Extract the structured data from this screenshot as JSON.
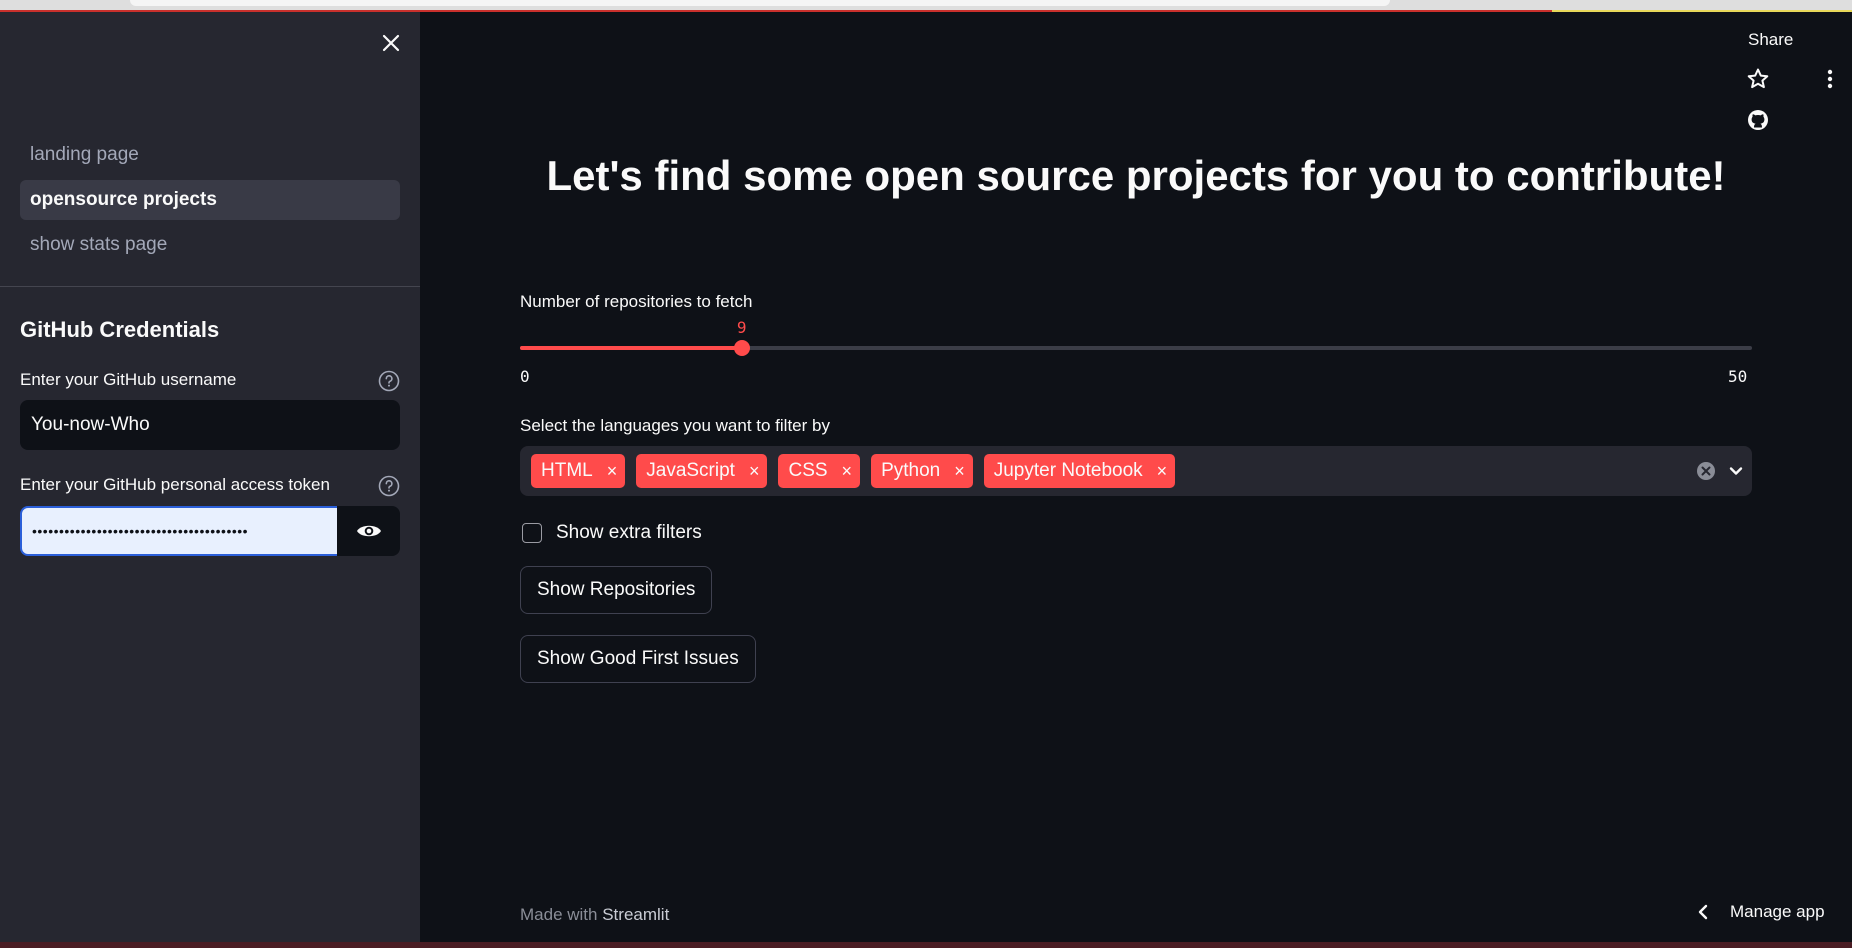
{
  "sidebar": {
    "nav_items": [
      {
        "label": "landing page",
        "active": false
      },
      {
        "label": "opensource projects",
        "active": true
      },
      {
        "label": "show stats page",
        "active": false
      }
    ],
    "section_title": "GitHub Credentials",
    "username_label": "Enter your GitHub username",
    "username_value": "You-now-Who",
    "token_label": "Enter your GitHub personal access token",
    "token_value": "••••••••••••••••••••••••••••••••••••••••"
  },
  "header": {
    "share_label": "Share"
  },
  "main": {
    "title": "Let's find some open source projects for you to contribute!",
    "slider": {
      "label": "Number of repositories to fetch",
      "value": 9,
      "min": 0,
      "max": 50
    },
    "languages": {
      "label": "Select the languages you want to filter by",
      "selected": [
        "HTML",
        "JavaScript",
        "CSS",
        "Python",
        "Jupyter Notebook"
      ],
      "chip_remove_glyph": "×"
    },
    "extra_filters_label": "Show extra filters",
    "show_repos_button": "Show Repositories",
    "show_issues_button": "Show Good First Issues"
  },
  "footer": {
    "made_with": "Made with",
    "brand": "Streamlit",
    "manage_app": "Manage app"
  },
  "colors": {
    "accent": "#ff4b4b",
    "background": "#0e1117",
    "sidebar": "#262730"
  }
}
